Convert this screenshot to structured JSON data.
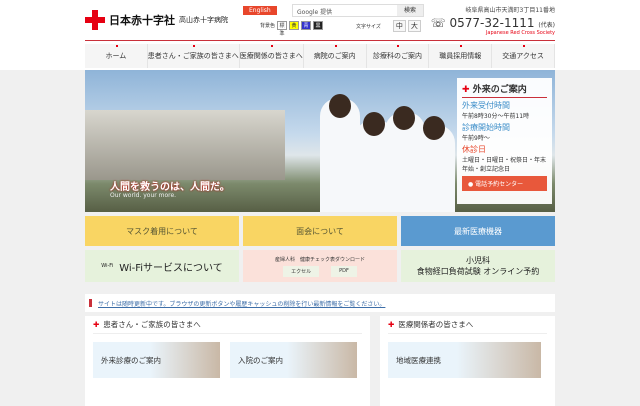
{
  "header": {
    "org": "日本赤十字社",
    "hospital": "高山赤十字病院",
    "english": "English",
    "search_label": "Google 提供",
    "search_button": "検索",
    "bg_label": "背景色",
    "bg_options": [
      "標準",
      "黄",
      "青",
      "黒"
    ],
    "font_label": "文字サイズ",
    "font_options": [
      "中",
      "大"
    ],
    "address": "岐阜県高山市天満町3丁目11番地",
    "tel": "0577-32-1111",
    "tel_note": "(代表)",
    "jrc": "Japanese Red Cross Society"
  },
  "nav": [
    "ホーム",
    "患者さん・ご家族の皆さまへ",
    "医療関係の皆さまへ",
    "病院のご案内",
    "診療科のご案内",
    "職員採用情報",
    "交通アクセス"
  ],
  "hero": {
    "tagline": "人間を救うのは、人間だ。",
    "sub": "Our world. your more."
  },
  "outpatient": {
    "title": "外来のご案内",
    "reception_label": "外来受付時間",
    "reception": "午前8時30分〜午前11時",
    "start_label": "診療開始時間",
    "start": "午前9時〜",
    "closed_label": "休診日",
    "closed": "土曜日・日曜日・祝祭日・年末年始・創立記念日",
    "button": "電話予約センター"
  },
  "tiles": {
    "mask": "マスク着用について",
    "visit": "面会について",
    "equipment": "最新医療機器",
    "wifi": "Wi-Fiサービスについて",
    "wifi_icon_text": "Wi-Fi",
    "obgyn": "産婦人科　健康チェック表ダウンロード",
    "excel": "エクセル",
    "pdf": "PDF",
    "pediatric1": "小児科",
    "pediatric2": "食物経口負荷試験 オンライン予約"
  },
  "notice": "サイトは随時更新中です。ブラウザの更新ボタンや履歴キャッシュの削除を行い最新情報をご覧ください。",
  "patients": {
    "title": "患者さん・ご家族の皆さまへ",
    "cards": [
      "外来診療のご案内",
      "入院のご案内"
    ]
  },
  "medical": {
    "title": "医療関係者の皆さまへ",
    "cards": [
      "地域医療連携"
    ]
  }
}
